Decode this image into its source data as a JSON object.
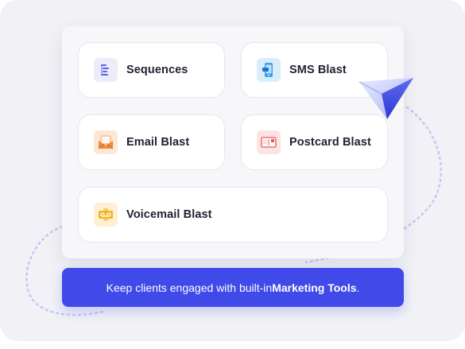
{
  "cards": [
    {
      "label": "Sequences",
      "icon": "sequences-icon"
    },
    {
      "label": "SMS Blast",
      "icon": "sms-phone-icon"
    },
    {
      "label": "Email Blast",
      "icon": "email-envelope-icon"
    },
    {
      "label": "Postcard Blast",
      "icon": "postcard-icon"
    },
    {
      "label": "Voicemail Blast",
      "icon": "voicemail-icon"
    }
  ],
  "banner": {
    "prefix": "Keep clients engaged with built-in ",
    "highlight": "Marketing Tools",
    "suffix": "."
  },
  "colors": {
    "accent": "#3f4ae8",
    "background": "#f1f1f6",
    "card": "#ffffff",
    "text": "#1f2233"
  }
}
